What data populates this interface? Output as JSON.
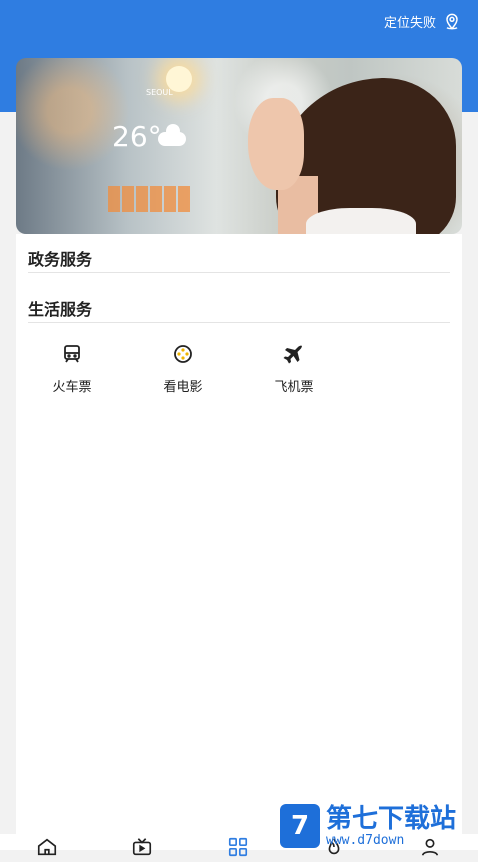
{
  "header": {
    "location_status": "定位失败",
    "location_icon": "location-pin-icon"
  },
  "sections": [
    {
      "title": "政务服务"
    },
    {
      "title": "生活服务",
      "items": [
        {
          "label": "火车票",
          "icon": "train-icon"
        },
        {
          "label": "看电影",
          "icon": "film-reel-icon"
        },
        {
          "label": "飞机票",
          "icon": "airplane-icon"
        }
      ]
    }
  ],
  "banner_text": {
    "city": "SEOUL",
    "temp": "26°"
  },
  "tabs": [
    {
      "icon": "home-icon"
    },
    {
      "icon": "tv-icon"
    },
    {
      "icon": "grid-icon",
      "active": true
    },
    {
      "icon": "fire-icon"
    },
    {
      "icon": "user-icon"
    }
  ],
  "watermark": {
    "logo": "7",
    "name": "第七下载站",
    "url": "www.d7down"
  },
  "colors": {
    "primary": "#2f7de1",
    "active_tab": "#2f7de1"
  }
}
